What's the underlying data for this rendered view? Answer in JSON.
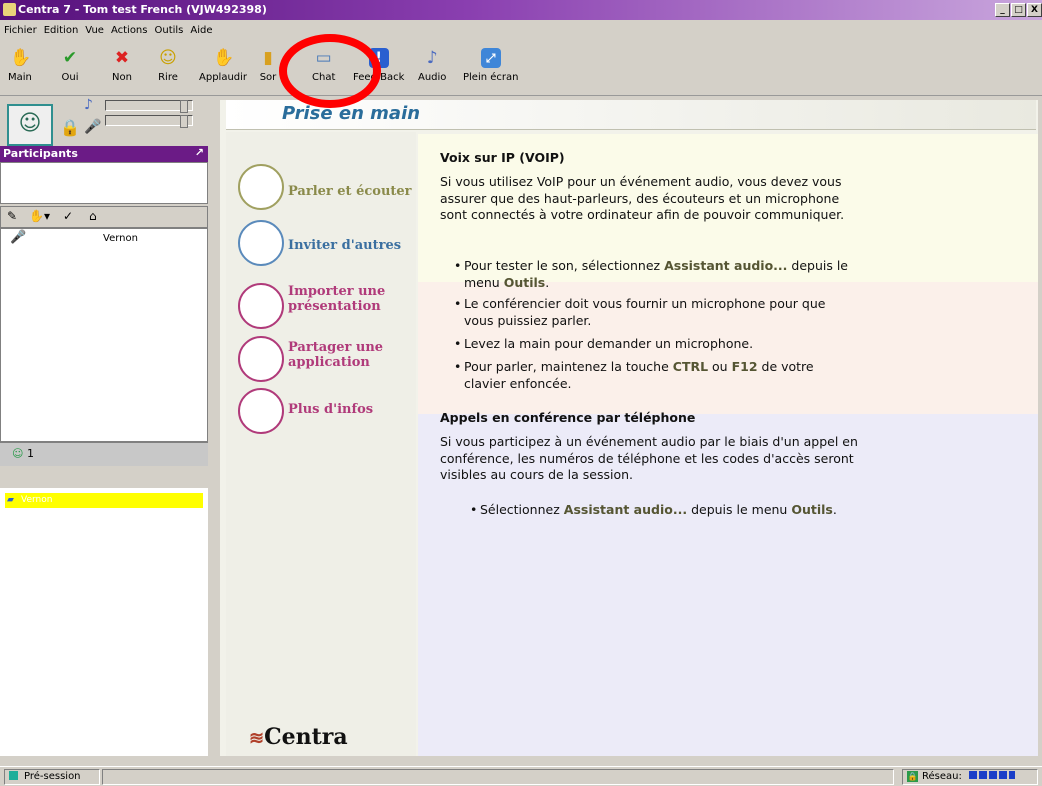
{
  "window": {
    "title": "Centra 7 - Tom test French (VJW492398)",
    "min": "_",
    "max": "□",
    "close": "X"
  },
  "menu": [
    "Fichier",
    "Edition",
    "Vue",
    "Actions",
    "Outils",
    "Aide"
  ],
  "toolbar": {
    "main": "Main",
    "oui": "Oui",
    "non": "Non",
    "rire": "Rire",
    "applaudir": "Applaudir",
    "sortir": "Sor",
    "chat": "Chat",
    "feedback": "Feed-Back",
    "audio": "Audio",
    "plein_ecran": "Plein écran"
  },
  "participants": {
    "header": "Participants",
    "participant_name": "Vernon",
    "count": "1",
    "lower_item": "Vernon"
  },
  "panel": {
    "title": "Prise en main"
  },
  "nav": [
    {
      "label": "Parler et écouter"
    },
    {
      "label": "Inviter d'autres"
    },
    {
      "label": "Importer une présentation"
    },
    {
      "label": "Partager une application"
    },
    {
      "label": "Plus d'infos"
    }
  ],
  "content": {
    "voip_heading": "Voix sur IP (VOIP)",
    "voip_intro": "Si vous utilisez VoIP pour un événement audio, vous devez vous assurer que des haut-parleurs, des écouteurs et un microphone sont connectés à votre ordinateur afin de pouvoir communiquer.",
    "b1_pre": "Pour tester le son, sélectionnez ",
    "b1_bold": "Assistant audio...",
    "b1_mid": " depuis le menu ",
    "b1_bold2": "Outils",
    "b1_end": ".",
    "b2": "Le conférencier doit vous fournir un microphone pour que vous puissiez parler.",
    "b3": "Levez la main pour demander un microphone.",
    "b4_pre": "Pour parler, maintenez la touche ",
    "b4_ctrl": "CTRL",
    "b4_mid": " ou ",
    "b4_f12": "F12",
    "b4_end": " de votre clavier enfoncée.",
    "phone_heading": "Appels en conférence par téléphone",
    "phone_intro": "Si vous participez à un événement audio par le biais d'un appel en conférence, les numéros de téléphone et les codes d'accès seront visibles au cours de la session.",
    "b5_pre": "Sélectionnez ",
    "b5_bold": "Assistant audio...",
    "b5_mid": " depuis le menu ",
    "b5_bold2": "Outils",
    "b5_end": "."
  },
  "logo": "Centra",
  "status": {
    "state": "Pré-session",
    "network": "Réseau:"
  }
}
